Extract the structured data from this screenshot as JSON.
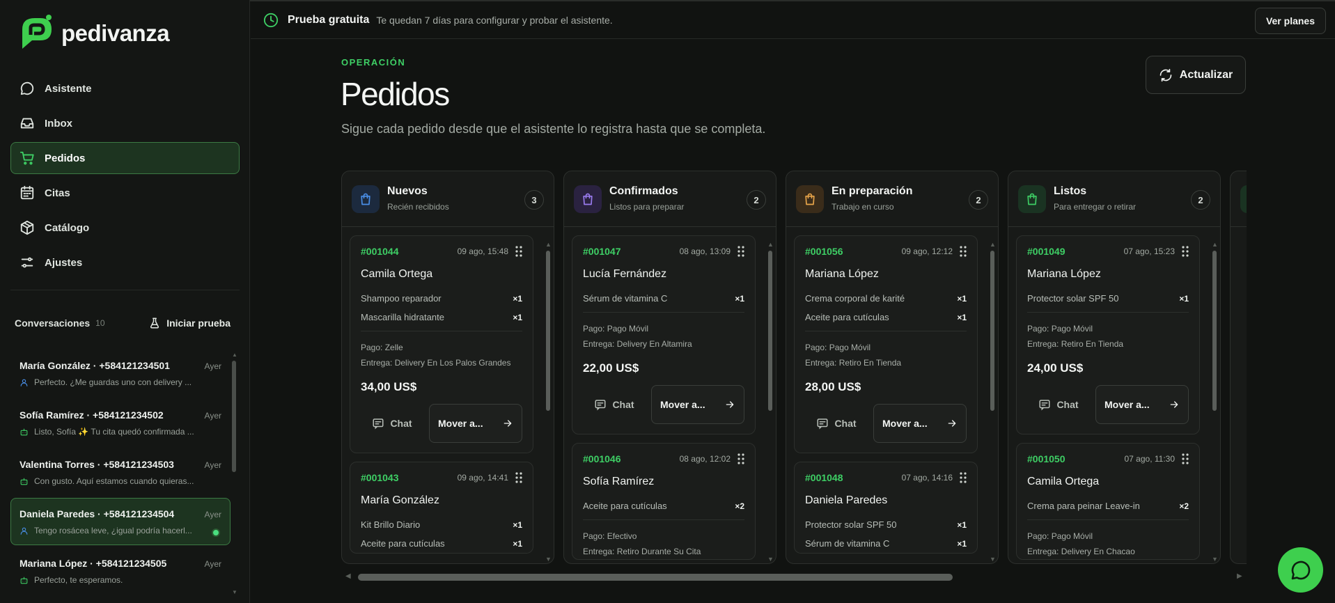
{
  "app": {
    "name": "pedivanza"
  },
  "colors": {
    "accent": "#3ecf65",
    "active_bg": "#1d3420",
    "fab": "#3ecf4e"
  },
  "sidebar": {
    "nav": [
      {
        "label": "Asistente",
        "icon": "chat-bubble-icon"
      },
      {
        "label": "Inbox",
        "icon": "inbox-icon"
      },
      {
        "label": "Pedidos",
        "icon": "cart-icon",
        "active": true
      },
      {
        "label": "Citas",
        "icon": "calendar-icon"
      },
      {
        "label": "Catálogo",
        "icon": "catalog-box-icon"
      },
      {
        "label": "Ajustes",
        "icon": "sliders-icon"
      }
    ],
    "conversations_title": "Conversaciones",
    "conversations_count": "10",
    "start_test_label": "Iniciar prueba",
    "conversations": [
      {
        "name": "María González · +584121234501",
        "time": "Ayer",
        "message": "Perfecto. ¿Me guardas uno con delivery ...",
        "icon": "user-icon"
      },
      {
        "name": "Sofía Ramírez · +584121234502",
        "time": "Ayer",
        "message": "Listo, Sofía ✨ Tu cita quedó confirmada ...",
        "icon": "bot-icon"
      },
      {
        "name": "Valentina Torres · +584121234503",
        "time": "Ayer",
        "message": "Con gusto. Aquí estamos cuando quieras...",
        "icon": "bot-icon"
      },
      {
        "name": "Daniela Paredes · +584121234504",
        "time": "Ayer",
        "message": "Tengo rosácea leve, ¿igual podría hacerl...",
        "icon": "user-icon",
        "active": true,
        "unread": true
      },
      {
        "name": "Mariana López · +584121234505",
        "time": "Ayer",
        "message": "Perfecto, te esperamos.",
        "icon": "bot-icon"
      }
    ]
  },
  "banner": {
    "title": "Prueba gratuita",
    "text": "Te quedan 7 días para configurar y probar el asistente.",
    "button": "Ver planes"
  },
  "header": {
    "eyebrow": "OPERACIÓN",
    "title": "Pedidos",
    "subtitle": "Sigue cada pedido desde que el asistente lo registra hasta que se completa.",
    "refresh_label": "Actualizar"
  },
  "labels": {
    "chat": "Chat",
    "move": "Mover a..."
  },
  "columns": [
    {
      "title": "Nuevos",
      "subtitle": "Recién recibidos",
      "count": "3",
      "color": "#4a8fe8",
      "bg": "#1c2a3e",
      "cards": [
        {
          "id": "#001044",
          "date": "09 ago, 15:48",
          "customer": "Camila Ortega",
          "items": [
            {
              "name": "Shampoo reparador",
              "qty": "×1"
            },
            {
              "name": "Mascarilla hidratante",
              "qty": "×1"
            }
          ],
          "payment": "Pago: Zelle",
          "delivery": "Entrega: Delivery En Los Palos Grandes",
          "total": "34,00 US$"
        },
        {
          "id": "#001043",
          "date": "09 ago, 14:41",
          "customer": "María González",
          "items": [
            {
              "name": "Kit Brillo Diario",
              "qty": "×1"
            },
            {
              "name": "Aceite para cutículas",
              "qty": "×1"
            }
          ]
        }
      ]
    },
    {
      "title": "Confirmados",
      "subtitle": "Listos para preparar",
      "count": "2",
      "color": "#9a7cf0",
      "bg": "#2a2240",
      "cards": [
        {
          "id": "#001047",
          "date": "08 ago, 13:09",
          "customer": "Lucía Fernández",
          "items": [
            {
              "name": "Sérum de vitamina C",
              "qty": "×1"
            }
          ],
          "payment": "Pago: Pago Móvil",
          "delivery": "Entrega: Delivery En Altamira",
          "total": "22,00 US$"
        },
        {
          "id": "#001046",
          "date": "08 ago, 12:02",
          "customer": "Sofía Ramírez",
          "items": [
            {
              "name": "Aceite para cutículas",
              "qty": "×2"
            }
          ],
          "payment": "Pago: Efectivo",
          "delivery": "Entrega: Retiro Durante Su Cita"
        }
      ]
    },
    {
      "title": "En preparación",
      "subtitle": "Trabajo en curso",
      "count": "2",
      "color": "#e8a54a",
      "bg": "#3a2c1a",
      "cards": [
        {
          "id": "#001056",
          "date": "09 ago, 12:12",
          "customer": "Mariana López",
          "items": [
            {
              "name": "Crema corporal de karité",
              "qty": "×1"
            },
            {
              "name": "Aceite para cutículas",
              "qty": "×1"
            }
          ],
          "payment": "Pago: Pago Móvil",
          "delivery": "Entrega: Retiro En Tienda",
          "total": "28,00 US$"
        },
        {
          "id": "#001048",
          "date": "07 ago, 14:16",
          "customer": "Daniela Paredes",
          "items": [
            {
              "name": "Protector solar SPF 50",
              "qty": "×1"
            },
            {
              "name": "Sérum de vitamina C",
              "qty": "×1"
            }
          ]
        }
      ]
    },
    {
      "title": "Listos",
      "subtitle": "Para entregar o retirar",
      "count": "2",
      "color": "#3ecf65",
      "bg": "#1a3322",
      "cards": [
        {
          "id": "#001049",
          "date": "07 ago, 15:23",
          "customer": "Mariana López",
          "items": [
            {
              "name": "Protector solar SPF 50",
              "qty": "×1"
            }
          ],
          "payment": "Pago: Pago Móvil",
          "delivery": "Entrega: Retiro En Tienda",
          "total": "24,00 US$"
        },
        {
          "id": "#001050",
          "date": "07 ago, 11:30",
          "customer": "Camila Ortega",
          "items": [
            {
              "name": "Crema para peinar Leave-in",
              "qty": "×2"
            }
          ],
          "payment": "Pago: Pago Móvil",
          "delivery": "Entrega: Delivery En Chacao"
        }
      ]
    }
  ]
}
